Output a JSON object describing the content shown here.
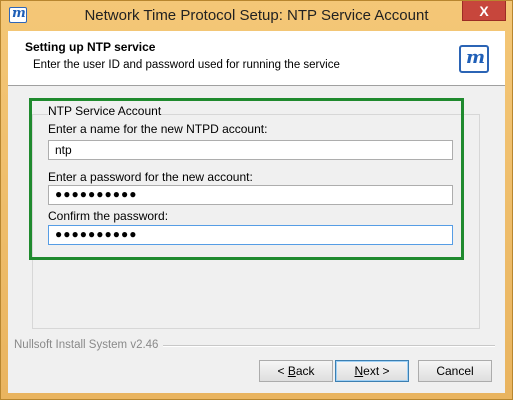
{
  "window": {
    "title": "Network Time Protocol Setup: NTP Service Account",
    "close_label": "X"
  },
  "header": {
    "title": "Setting up NTP service",
    "subtitle": "Enter the user ID and password used for running the service",
    "logo_letter": "m"
  },
  "group": {
    "label": "NTP Service Account",
    "fields": [
      {
        "label": "Enter a name for the new NTPD account:",
        "value": "ntp"
      },
      {
        "label": "Enter a password for the new account:",
        "value": "●●●●●●●●●●"
      },
      {
        "label": "Confirm the password:",
        "value": "●●●●●●●●●●"
      }
    ]
  },
  "footer": {
    "brand": "Nullsoft Install System v2.46",
    "back_prefix": "< ",
    "back_key": "B",
    "back_rest": "ack",
    "next_key": "N",
    "next_rest": "ext >",
    "cancel_label": "Cancel"
  }
}
